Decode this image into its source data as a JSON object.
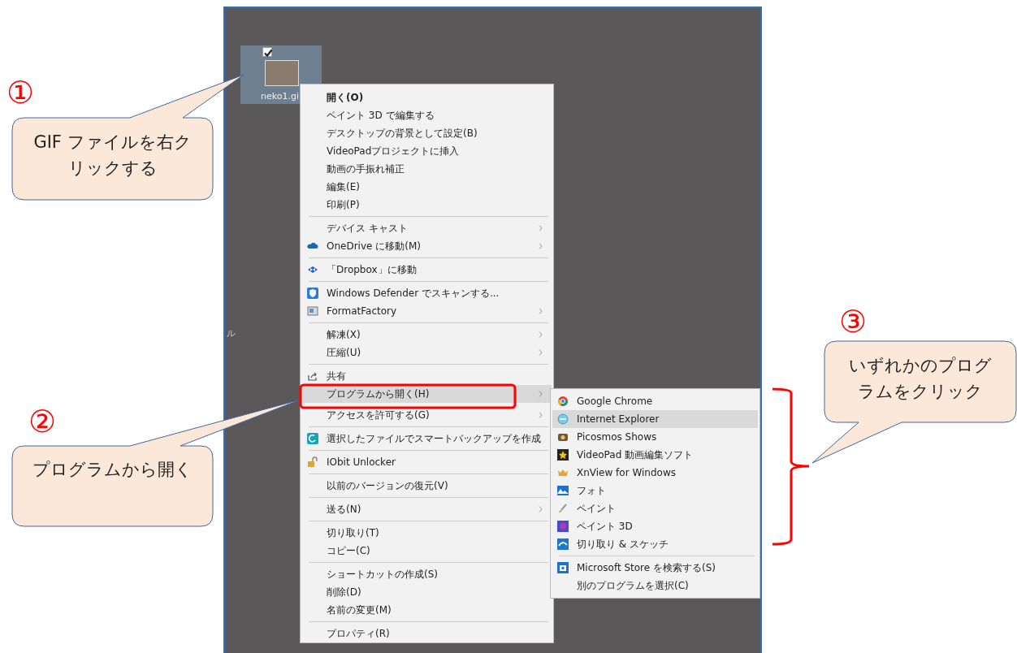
{
  "desktop": {
    "file_icon": {
      "checked": true,
      "label": "neko1.gi"
    },
    "edge_fragment": "ル"
  },
  "context_menu": {
    "items": [
      {
        "kind": "item",
        "label": "開く(O)",
        "default": true,
        "submenu": false,
        "selected": false
      },
      {
        "kind": "item",
        "label": "ペイント 3D で編集する",
        "default": false,
        "submenu": false,
        "selected": false
      },
      {
        "kind": "item",
        "label": "デスクトップの背景として設定(B)",
        "default": false,
        "submenu": false,
        "selected": false
      },
      {
        "kind": "item",
        "label": "VideoPadプロジェクトに挿入",
        "default": false,
        "submenu": false,
        "selected": false
      },
      {
        "kind": "item",
        "label": "動画の手振れ補正",
        "default": false,
        "submenu": false,
        "selected": false
      },
      {
        "kind": "item",
        "label": "編集(E)",
        "default": false,
        "submenu": false,
        "selected": false
      },
      {
        "kind": "item",
        "label": "印刷(P)",
        "default": false,
        "submenu": false,
        "selected": false
      },
      {
        "kind": "separator"
      },
      {
        "kind": "item",
        "label": "デバイス キャスト",
        "default": false,
        "submenu": true,
        "selected": false
      },
      {
        "kind": "item",
        "label": "OneDrive に移動(M)",
        "default": false,
        "submenu": true,
        "selected": false
      },
      {
        "kind": "separator"
      },
      {
        "kind": "item",
        "label": "「Dropbox」に移動",
        "default": false,
        "submenu": false,
        "selected": false
      },
      {
        "kind": "separator"
      },
      {
        "kind": "item",
        "label": "Windows Defender でスキャンする...",
        "default": false,
        "submenu": false,
        "selected": false
      },
      {
        "kind": "item",
        "label": "FormatFactory",
        "default": false,
        "submenu": true,
        "selected": false
      },
      {
        "kind": "separator"
      },
      {
        "kind": "item",
        "label": "解凍(X)",
        "default": false,
        "submenu": true,
        "selected": false
      },
      {
        "kind": "item",
        "label": "圧縮(U)",
        "default": false,
        "submenu": true,
        "selected": false
      },
      {
        "kind": "separator"
      },
      {
        "kind": "item",
        "label": "共有",
        "default": false,
        "submenu": false,
        "selected": false
      },
      {
        "kind": "item",
        "label": "プログラムから開く(H)",
        "default": false,
        "submenu": true,
        "selected": true
      },
      {
        "kind": "item",
        "label": "アクセスを許可する(G)",
        "default": false,
        "submenu": true,
        "selected": false
      },
      {
        "kind": "separator"
      },
      {
        "kind": "item",
        "label": "選択したファイルでスマートバックアップを作成",
        "default": false,
        "submenu": false,
        "selected": false
      },
      {
        "kind": "separator"
      },
      {
        "kind": "item",
        "label": "IObit Unlocker",
        "default": false,
        "submenu": false,
        "selected": false
      },
      {
        "kind": "separator"
      },
      {
        "kind": "item",
        "label": "以前のバージョンの復元(V)",
        "default": false,
        "submenu": false,
        "selected": false
      },
      {
        "kind": "separator"
      },
      {
        "kind": "item",
        "label": "送る(N)",
        "default": false,
        "submenu": true,
        "selected": false
      },
      {
        "kind": "separator"
      },
      {
        "kind": "item",
        "label": "切り取り(T)",
        "default": false,
        "submenu": false,
        "selected": false
      },
      {
        "kind": "item",
        "label": "コピー(C)",
        "default": false,
        "submenu": false,
        "selected": false
      },
      {
        "kind": "separator"
      },
      {
        "kind": "item",
        "label": "ショートカットの作成(S)",
        "default": false,
        "submenu": false,
        "selected": false
      },
      {
        "kind": "item",
        "label": "削除(D)",
        "default": false,
        "submenu": false,
        "selected": false
      },
      {
        "kind": "item",
        "label": "名前の変更(M)",
        "default": false,
        "submenu": false,
        "selected": false
      },
      {
        "kind": "separator"
      },
      {
        "kind": "item",
        "label": "プロパティ(R)",
        "default": false,
        "submenu": false,
        "selected": false
      }
    ]
  },
  "open_with_menu": {
    "items": [
      {
        "kind": "item",
        "label": "Google Chrome",
        "selected": false
      },
      {
        "kind": "item",
        "label": "Internet Explorer",
        "selected": true
      },
      {
        "kind": "item",
        "label": "Picosmos Shows",
        "selected": false
      },
      {
        "kind": "item",
        "label": "VideoPad 動画編集ソフト",
        "selected": false
      },
      {
        "kind": "item",
        "label": "XnView for Windows",
        "selected": false
      },
      {
        "kind": "item",
        "label": "フォト",
        "selected": false
      },
      {
        "kind": "item",
        "label": "ペイント",
        "selected": false
      },
      {
        "kind": "item",
        "label": "ペイント 3D",
        "selected": false
      },
      {
        "kind": "item",
        "label": "切り取り & スケッチ",
        "selected": false
      },
      {
        "kind": "separator"
      },
      {
        "kind": "item",
        "label": "Microsoft Store を検索する(S)",
        "selected": false
      },
      {
        "kind": "item",
        "label": "別のプログラムを選択(C)",
        "selected": false
      }
    ]
  },
  "callouts": [
    {
      "number": "①",
      "text": "GIF ファイルを右クリックする"
    },
    {
      "number": "②",
      "text": "プログラムから開く"
    },
    {
      "number": "③",
      "text": "いずれかのプログラムをクリック"
    }
  ]
}
